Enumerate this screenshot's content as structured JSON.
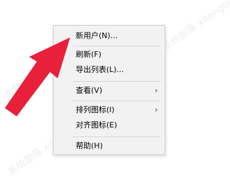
{
  "watermark": {
    "text": "系统部落 xitongbuluo"
  },
  "context_menu": {
    "items": [
      {
        "label": "新用户(N)...",
        "has_submenu": false
      },
      {
        "label": "刷新(F)",
        "has_submenu": false
      },
      {
        "label": "导出列表(L)...",
        "has_submenu": false
      },
      {
        "label": "查看(V)",
        "has_submenu": true
      },
      {
        "label": "排列图标(I)",
        "has_submenu": true
      },
      {
        "label": "对齐图标(E)",
        "has_submenu": false
      },
      {
        "label": "帮助(H)",
        "has_submenu": false
      }
    ],
    "submenu_glyph": "›"
  },
  "annotation": {
    "color": "#e8203a",
    "icon": "red-arrow-icon"
  }
}
